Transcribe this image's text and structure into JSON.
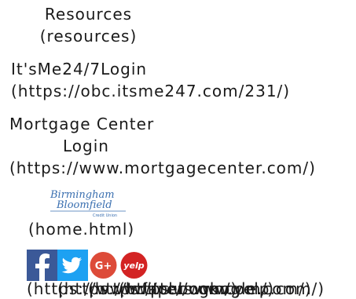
{
  "links": [
    {
      "label": "Resources",
      "href_text": "(resources)"
    },
    {
      "label": "It'sMe24/7Login",
      "href_text": "(https://obc.itsme247.com/231/)"
    },
    {
      "label_line1": "Mortgage Center",
      "label_line2": "Login",
      "href_text": "(https://www.mortgagecenter.com/)"
    }
  ],
  "home": {
    "logo_text": {
      "line1": "Birmingham",
      "line2": "Bloomfield",
      "line3": "Credit Union"
    },
    "href_text": "(home.html)"
  },
  "social": [
    {
      "icon": "facebook-icon",
      "color": "#3b5998"
    },
    {
      "icon": "twitter-icon",
      "color": "#1da1f2"
    },
    {
      "icon": "google-plus-icon",
      "color": "#dd4b39",
      "text": "G+"
    },
    {
      "icon": "yelp-icon",
      "color": "#d32323",
      "text": "yelp"
    }
  ],
  "social_urls": [
    "(https://www.facebook.com/)",
    "(https://twitter.com/)",
    "(https://plus.google.com/)",
    "(https://www.yelp.com/)"
  ]
}
